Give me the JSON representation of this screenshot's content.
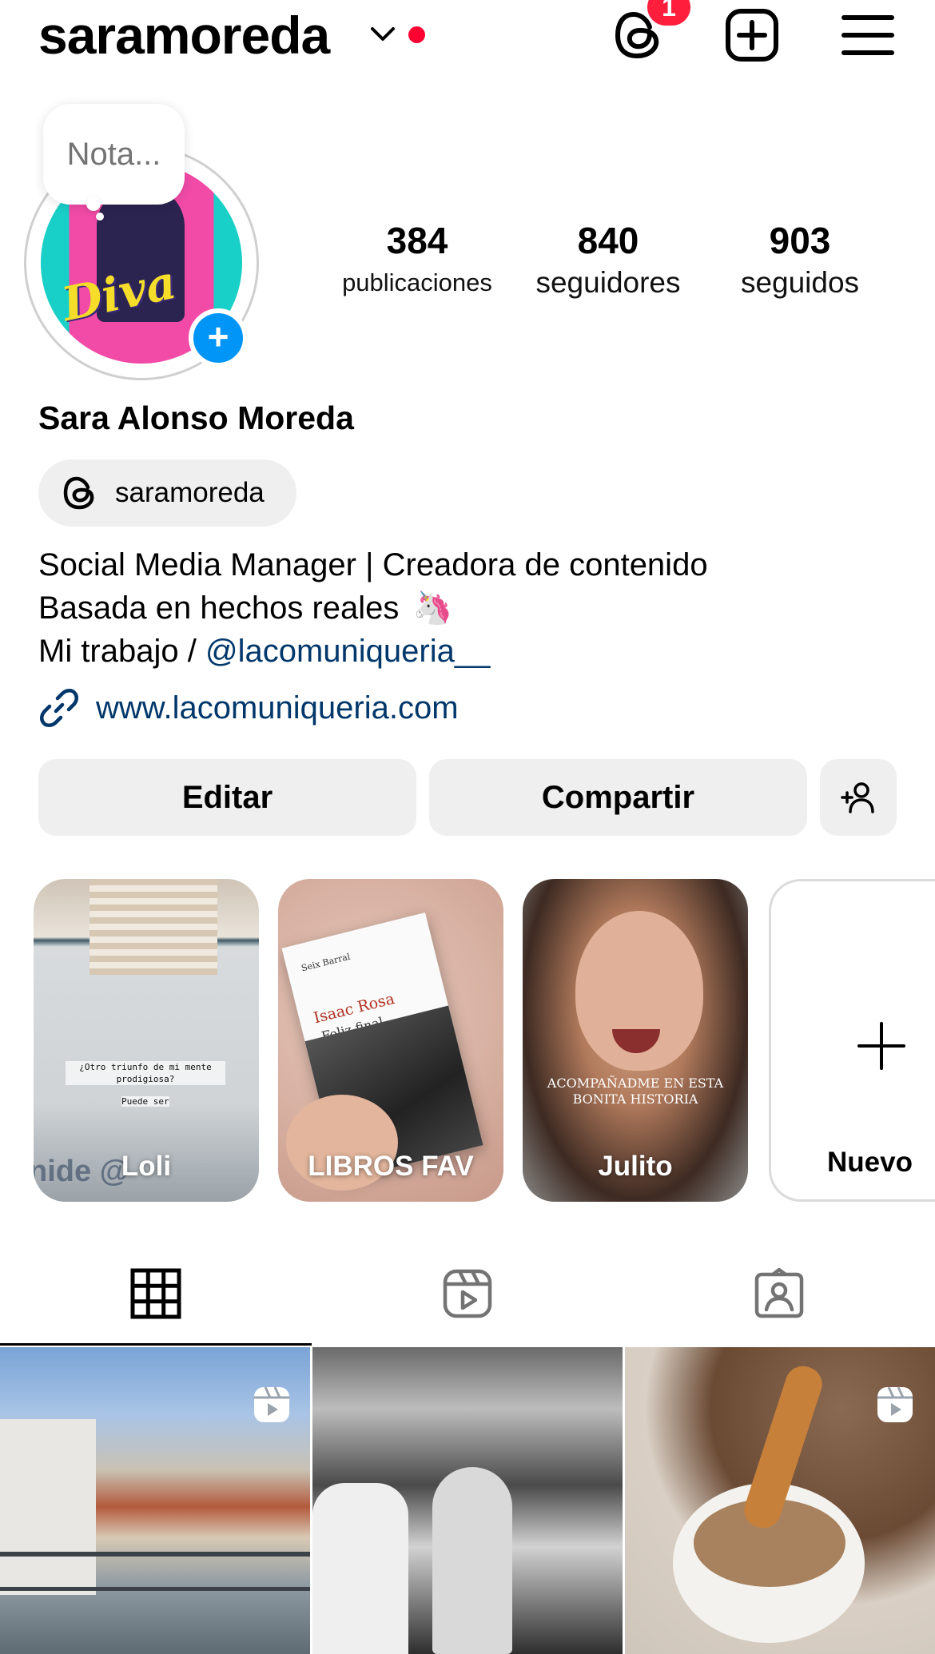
{
  "header": {
    "username": "saramoreda",
    "threads_badge": "1",
    "icons": [
      "chevron-down-icon",
      "threads-icon",
      "plus-square-icon",
      "hamburger-menu-icon"
    ],
    "accent_red": "#ff0033"
  },
  "profile": {
    "note_placeholder": "Nota...",
    "stats": {
      "posts": {
        "value": "384",
        "label": "publicaciones"
      },
      "followers": {
        "value": "840",
        "label": "seguidores"
      },
      "following": {
        "value": "903",
        "label": "seguidos"
      }
    },
    "full_name": "Sara Alonso Moreda",
    "threads_handle": "saramoreda",
    "bio": {
      "line1": "Social Media Manager | Creadora de contenido",
      "line2": "Basada en hechos reales",
      "line2_emoji": "🦄",
      "line3_prefix": "Mi trabajo / ",
      "line3_mention": "@lacomuniqueria__"
    },
    "link": "www.lacomuniqueria.com",
    "link_color": "#00376b"
  },
  "actions": {
    "edit": "Editar",
    "share": "Compartir"
  },
  "highlights": [
    {
      "label": "Loli",
      "caption": "¿Otro triunfo de mi mente prodigiosa?",
      "caption2": "Puede ser",
      "edge_text": "nide @"
    },
    {
      "label": "LIBROS FAV",
      "book_brand": "Seix Barral",
      "book_author": "Isaac Rosa",
      "book_title": "Feliz final"
    },
    {
      "label": "Julito",
      "overlay": "ACOMPAÑADME EN ESTA BONITA HISTORIA"
    },
    {
      "label": "Nuevo"
    }
  ],
  "tabs": [
    "grid-icon",
    "reels-icon",
    "tagged-icon"
  ],
  "posts": [
    {
      "type": "reel"
    },
    {
      "type": "photo"
    },
    {
      "type": "reel"
    }
  ]
}
